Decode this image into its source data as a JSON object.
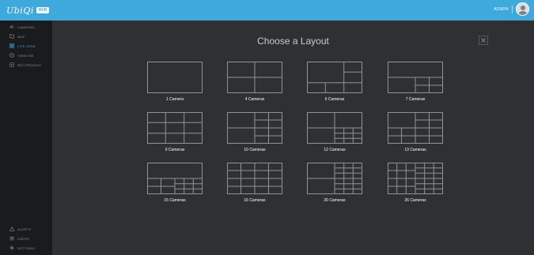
{
  "app": {
    "logo_text": "UbiQi",
    "logo_badge": "NVR"
  },
  "header": {
    "user_name": "ADMIN"
  },
  "sidebar": {
    "items": [
      {
        "label": "CAMERAS",
        "icon": "cameras-icon"
      },
      {
        "label": "MAP",
        "icon": "map-icon"
      },
      {
        "label": "LIVE VIEW",
        "icon": "live-view-icon",
        "active": true
      },
      {
        "label": "TIMELINE",
        "icon": "timeline-icon"
      },
      {
        "label": "RECORDINGS",
        "icon": "recordings-icon"
      }
    ],
    "bottom_items": [
      {
        "label": "ALERTS",
        "icon": "bell-icon"
      },
      {
        "label": "USERS",
        "icon": "users-icon"
      },
      {
        "label": "SETTINGS",
        "icon": "gear-icon"
      }
    ]
  },
  "main": {
    "title": "Choose a Layout",
    "layouts": [
      {
        "label": "1 Camera"
      },
      {
        "label": "4 Cameras"
      },
      {
        "label": "6 Cameras"
      },
      {
        "label": "7 Cameras"
      },
      {
        "label": "9 Cameras"
      },
      {
        "label": "10 Cameras"
      },
      {
        "label": "12 Cameras"
      },
      {
        "label": "13 Cameras"
      },
      {
        "label": "15 Cameras"
      },
      {
        "label": "16 Cameras"
      },
      {
        "label": "20 Cameras"
      },
      {
        "label": "26 Cameras"
      }
    ]
  },
  "colors": {
    "accent": "#3fa9de",
    "background": "#2f3033",
    "sidebar": "#1a1b1d",
    "grid_line": "#8f9297"
  }
}
